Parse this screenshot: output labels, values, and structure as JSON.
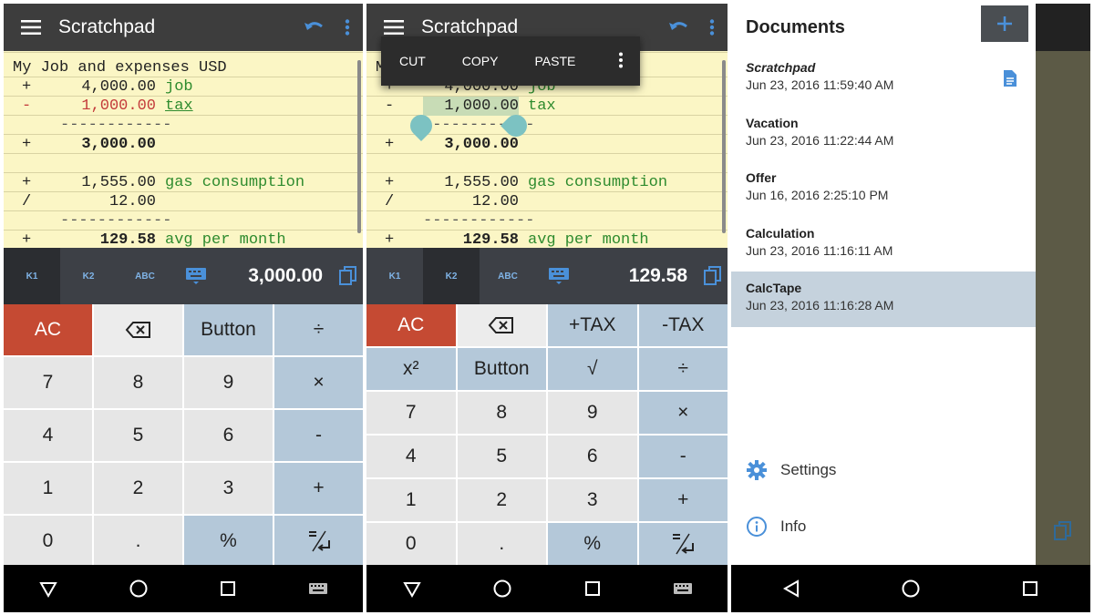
{
  "colors": {
    "accent": "#4a90d9",
    "ac_key": "#c54a33",
    "comment": "#2e8b2e",
    "negative": "#c43c3c",
    "tape": "#fbf6c5",
    "selected_doc": "#c5d2dd"
  },
  "panel1": {
    "title": "Scratchpad",
    "tape": {
      "header": "My Job and expenses USD",
      "lines": [
        {
          "op": "+",
          "num": "4,000.00",
          "cmt": "job"
        },
        {
          "op": "-",
          "num": "1,000.00",
          "cmt": "tax"
        },
        {
          "dash": "------------"
        },
        {
          "op": "+",
          "num": "3,000.00",
          "cmt": ""
        },
        {
          "op": "+",
          "num": "1,555.00",
          "cmt": "gas consumption"
        },
        {
          "op": "/",
          "num": "12.00",
          "cmt": ""
        },
        {
          "dash": "------------"
        },
        {
          "op": "+",
          "num": "129.58",
          "cmt": "avg per month"
        }
      ]
    },
    "tabs": [
      "K1",
      "K2",
      "ABC"
    ],
    "display": "3,000.00",
    "keys": [
      "AC",
      "",
      "Button",
      "÷",
      "7",
      "8",
      "9",
      "×",
      "4",
      "5",
      "6",
      "-",
      "1",
      "2",
      "3",
      "+",
      "0",
      ".",
      "%",
      ""
    ]
  },
  "panel2": {
    "title": "Scratchpad",
    "context_menu": [
      "CUT",
      "COPY",
      "PASTE"
    ],
    "display": "129.58",
    "keys": [
      "AC",
      "",
      "+TAX",
      "-TAX",
      "x²",
      "Button",
      "√",
      "÷",
      "7",
      "8",
      "9",
      "×",
      "4",
      "5",
      "6",
      "-",
      "1",
      "2",
      "3",
      "+",
      "0",
      ".",
      "%",
      ""
    ]
  },
  "panel3": {
    "drawer_title": "Documents",
    "documents": [
      {
        "name": "Scratchpad",
        "date": "Jun 23, 2016 11:59:40 AM"
      },
      {
        "name": "Vacation",
        "date": "Jun 23, 2016 11:22:44 AM"
      },
      {
        "name": "Offer",
        "date": "Jun 16, 2016 2:25:10 PM"
      },
      {
        "name": "Calculation",
        "date": "Jun 23, 2016 11:16:11 AM"
      },
      {
        "name": "CalcTape",
        "date": "Jun 23, 2016 11:16:28 AM"
      }
    ],
    "settings_label": "Settings",
    "info_label": "Info"
  }
}
